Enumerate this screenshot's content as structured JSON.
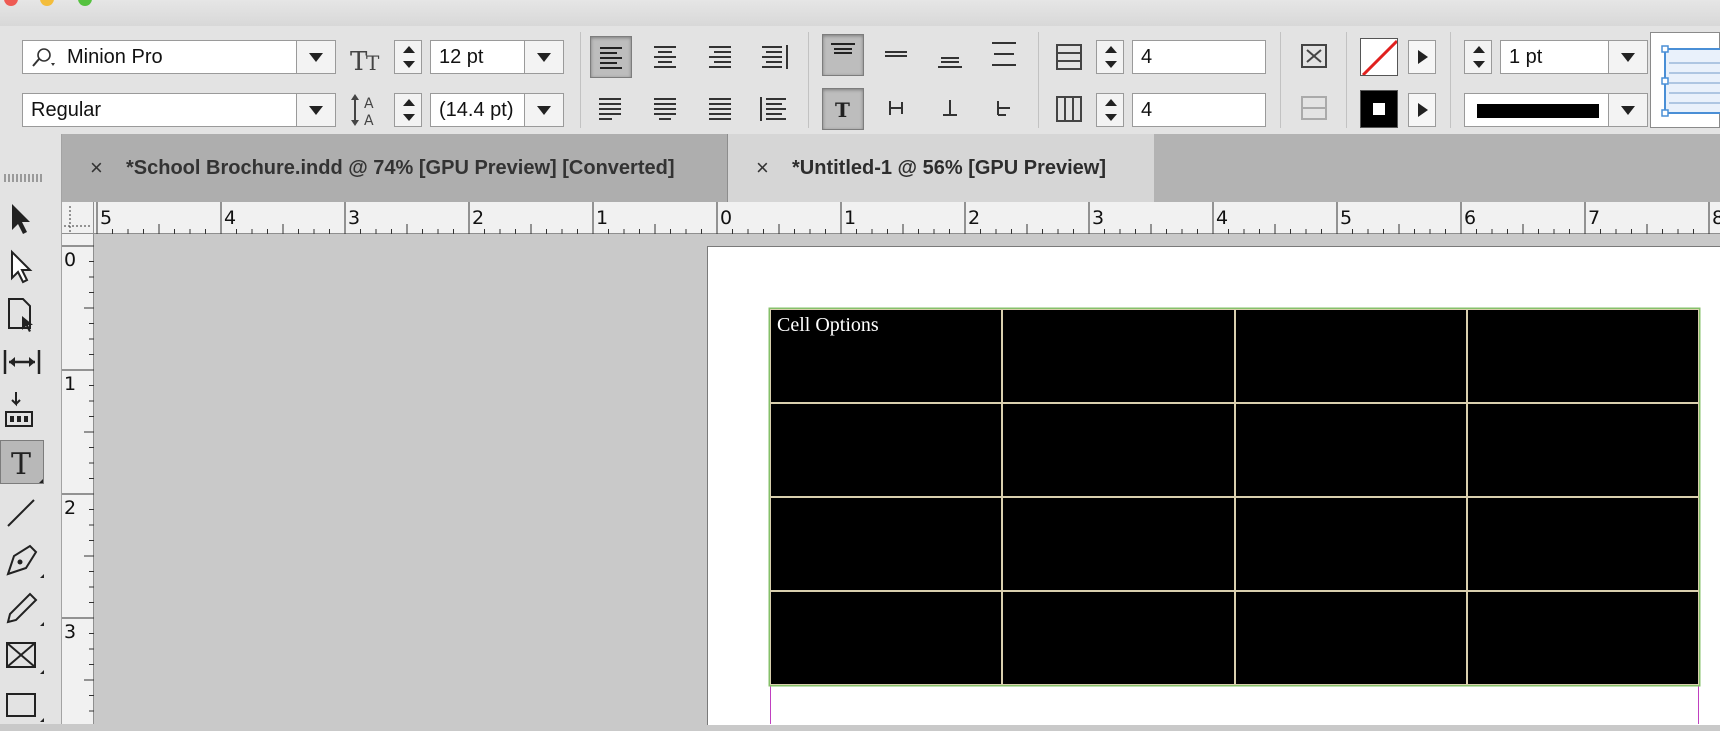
{
  "control_panel": {
    "font_family": "Minion Pro",
    "font_style": "Regular",
    "font_size": "12 pt",
    "leading": "(14.4 pt)",
    "rows": "4",
    "columns": "4",
    "stroke_weight": "1 pt"
  },
  "tabs": [
    {
      "label": "*School Brochure.indd @ 74% [GPU Preview] [Converted]",
      "active": false
    },
    {
      "label": "*Untitled-1 @ 56% [GPU Preview]",
      "active": true
    }
  ],
  "horizontal_ruler": {
    "labels": [
      "5",
      "4",
      "3",
      "2",
      "1",
      "0",
      "1",
      "2",
      "3",
      "4",
      "5",
      "6",
      "7",
      "8"
    ]
  },
  "vertical_ruler": {
    "labels": [
      "0",
      "1",
      "2",
      "3"
    ]
  },
  "document": {
    "table": {
      "rows": 4,
      "columns": 4,
      "fill_color": "#000000",
      "first_cell_text": "Cell Options"
    }
  },
  "colors": {
    "frame_edge": "#86c06a",
    "cell_stroke": "#d9cfae",
    "table_fill": "#000000",
    "stroke_swatch": "#000000",
    "fill_swatch_none_slash": "#e0201e"
  }
}
